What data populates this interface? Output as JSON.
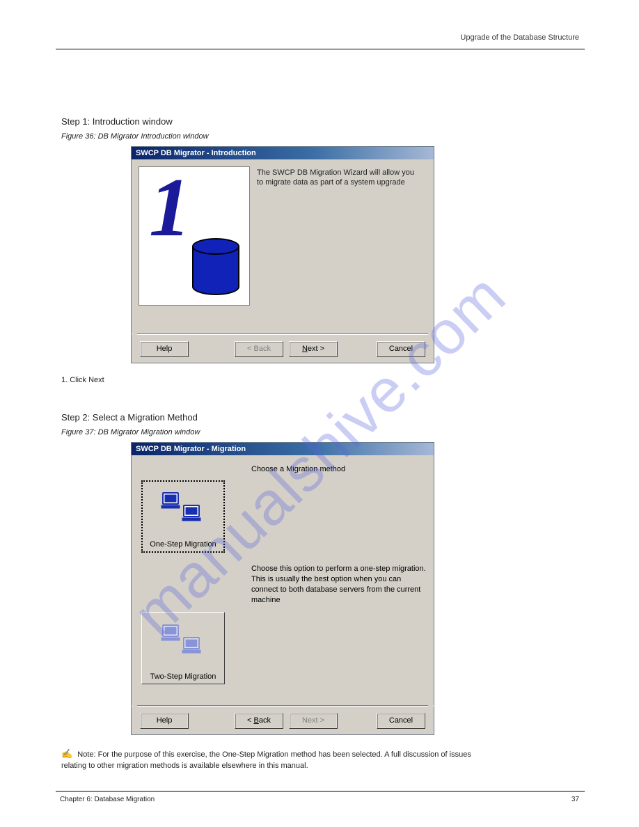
{
  "header": {
    "right": "Upgrade of the Database Structure"
  },
  "section1": {
    "title": "Step 1: Introduction window",
    "caption": "Figure 36: DB Migrator Introduction window"
  },
  "dialog1": {
    "title": "SWCP DB Migrator - Introduction",
    "body_text": "The SWCP DB Migration Wizard will allow you to migrate data as part of a system upgrade",
    "buttons": {
      "help": "Help",
      "back": "< Back",
      "next": "Next >",
      "cancel": "Cancel"
    }
  },
  "step1_instruction": "1. Click Next",
  "section2": {
    "title": "Step 2: Select a Migration Method",
    "caption": "Figure 37: DB Migrator Migration window"
  },
  "dialog2": {
    "title": "SWCP DB Migrator - Migration",
    "prompt": "Choose a Migration method",
    "option1_label": "One-Step Migration",
    "option2_label": "Two-Step Migration",
    "description": "Choose this option to perform a one-step migration. This is usually the best option when you can connect to both database servers from the current machine",
    "buttons": {
      "help": "Help",
      "back": "< Back",
      "next": "Next >",
      "cancel": "Cancel"
    }
  },
  "note": {
    "symbol": "✍",
    "text": "Note: For the purpose of this exercise, the One-Step Migration method has been selected. A full discussion of issues relating to other migration methods is available elsewhere in this manual."
  },
  "footer": {
    "left": "Chapter 6: Database Migration",
    "right": "37"
  },
  "watermark": "manualshive.com"
}
